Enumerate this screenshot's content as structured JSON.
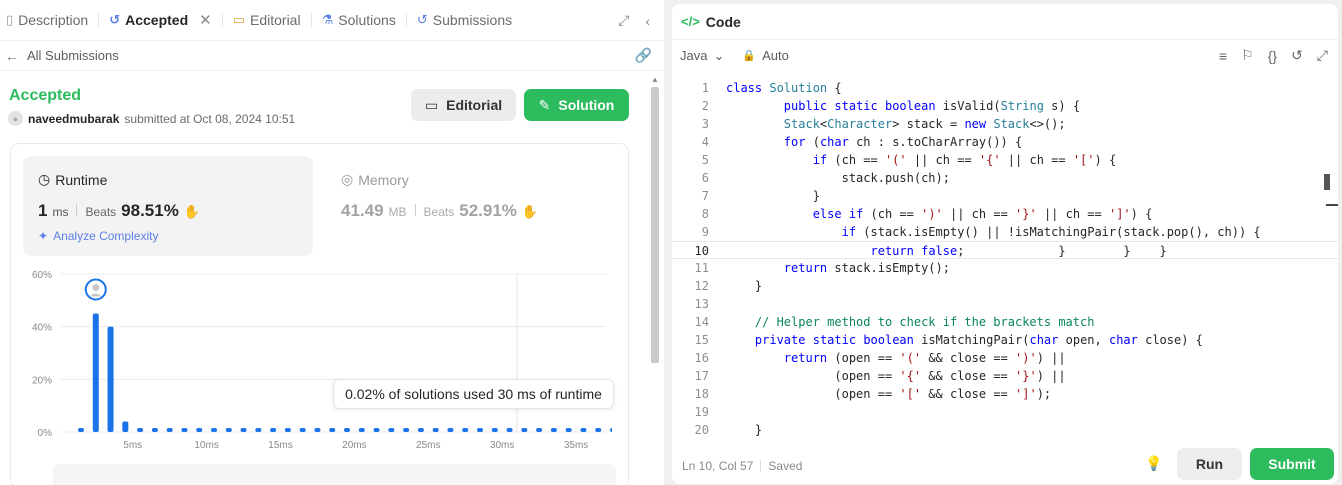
{
  "tabs": [
    {
      "label": "Description",
      "icon": "document-icon"
    },
    {
      "label": "Accepted",
      "icon": "history-icon"
    },
    {
      "label": "Editorial",
      "icon": "book-icon"
    },
    {
      "label": "Solutions",
      "icon": "flask-icon"
    },
    {
      "label": "Submissions",
      "icon": "history-icon"
    }
  ],
  "back_link": "All Submissions",
  "submission": {
    "status": "Accepted",
    "username": "naveedmubarak",
    "submitted_text": "submitted at Oct 08, 2024 10:51",
    "editorial_button": "Editorial",
    "solution_button": "Solution"
  },
  "runtime": {
    "label": "Runtime",
    "value": "1",
    "unit": "ms",
    "beats_label": "Beats",
    "beats_value": "98.51%",
    "analyze": "Analyze Complexity"
  },
  "memory": {
    "label": "Memory",
    "value": "41.49",
    "unit": "MB",
    "beats_label": "Beats",
    "beats_value": "52.91%"
  },
  "chart_data": {
    "type": "bar",
    "x_tick_labels": [
      "5ms",
      "10ms",
      "15ms",
      "20ms",
      "25ms",
      "30ms",
      "35ms"
    ],
    "y_tick_labels": [
      "60%",
      "40%",
      "20%",
      "0%"
    ],
    "ylim": [
      0,
      60
    ],
    "values": [
      1.5,
      45,
      40,
      4,
      1.5,
      1.5,
      1.5,
      1.5,
      1.5,
      1.5,
      1.5,
      1.5,
      1.5,
      1.5,
      1.5,
      1.5,
      1.5,
      1.5,
      1.5,
      1.5,
      1.5,
      1.5,
      1.5,
      1.5,
      1.5,
      1.5,
      1.5,
      1.5,
      1.5,
      1.5,
      1.5,
      1.5,
      1.5,
      1.5,
      1.5,
      1.5,
      1.5
    ],
    "highlight_index": 1,
    "tooltip": "0.02% of solutions used 30 ms of runtime",
    "accent": "#1a73e8"
  },
  "editor": {
    "title": "Code",
    "language": "Java",
    "mode": "Auto",
    "cursor": "Ln 10, Col 57",
    "saved": "Saved",
    "run_button": "Run",
    "submit_button": "Submit",
    "lines": [
      "class Solution {",
      "        public static boolean isValid(String s) {",
      "    Stack<Character> stack = new Stack<>();",
      "    for (char ch : s.toCharArray()) {",
      "        if (ch == '(' || ch == '{' || ch == '[') {",
      "            stack.push(ch);",
      "        }",
      "        else if (ch == ')' || ch == '}' || ch == ']') {",
      "            if (stack.isEmpty() || !isMatchingPair(stack.pop(), ch)) {",
      "                return false;             }        }    }",
      "    return stack.isEmpty();",
      "}",
      "",
      "// Helper method to check if the brackets match",
      "private static boolean isMatchingPair(char open, char close) {",
      "    return (open == '(' && close == ')') ||",
      "           (open == '{' && close == '}') ||",
      "           (open == '[' && close == ']');",
      "",
      "}"
    ],
    "indent": [
      0,
      0,
      1,
      1,
      1,
      1,
      1,
      1,
      1,
      1,
      1,
      1,
      1,
      1,
      1,
      1,
      1,
      1,
      1,
      1
    ],
    "current_line": 10
  },
  "colors": {
    "accent_green": "#2cbb5d",
    "bar_blue": "#1a73e8"
  }
}
